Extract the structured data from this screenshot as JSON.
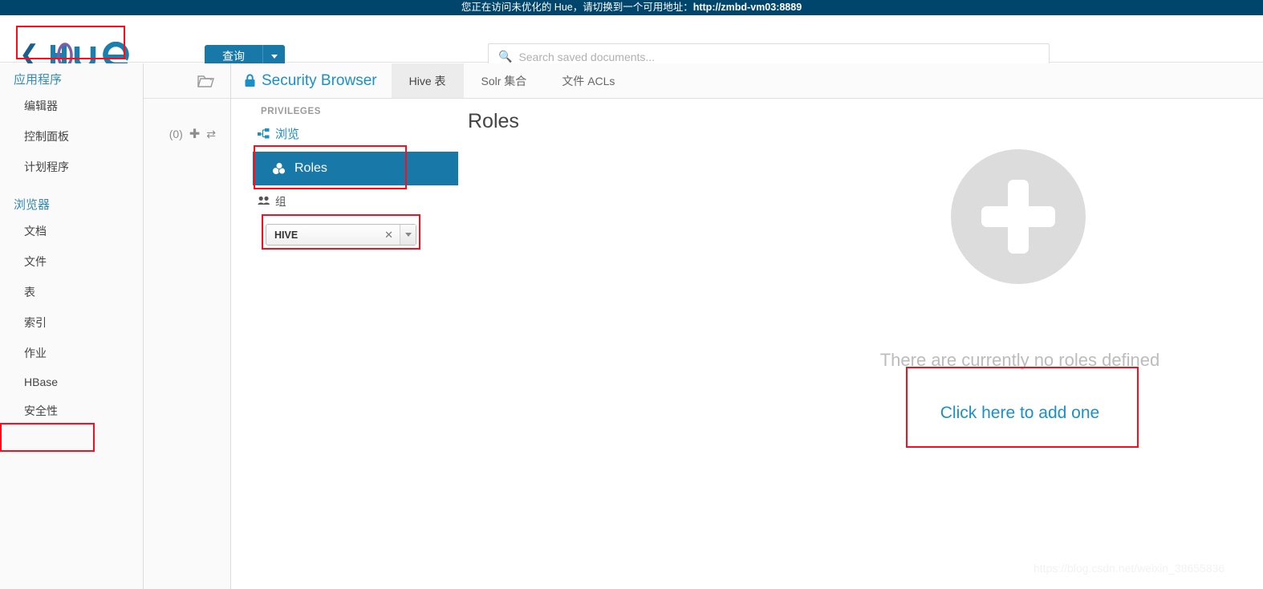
{
  "banner": {
    "text": "您正在访问未优化的 Hue，请切换到一个可用地址：",
    "url": "http://zmbd-vm03:8889"
  },
  "header": {
    "back_icon": "chevron-left-icon",
    "logo_text": "hue",
    "query_button": "查询",
    "query_caret_icon": "caret-down-icon",
    "search": {
      "icon": "search-icon",
      "placeholder": "Search saved documents...",
      "value": ""
    }
  },
  "sidebar": {
    "groups": [
      {
        "label": "应用程序",
        "items": [
          {
            "label": "编辑器"
          },
          {
            "label": "控制面板"
          },
          {
            "label": "计划程序"
          }
        ]
      },
      {
        "label": "浏览器",
        "items": [
          {
            "label": "文档"
          },
          {
            "label": "文件"
          },
          {
            "label": "表"
          },
          {
            "label": "索引"
          },
          {
            "label": "作业"
          },
          {
            "label": "HBase"
          },
          {
            "label": "安全性"
          }
        ]
      }
    ]
  },
  "assist": {
    "folder_icon": "folder-icon",
    "count": "(0)",
    "add_icon": "plus-icon",
    "refresh_icon": "refresh-icon"
  },
  "tabs": {
    "brand": {
      "label": "Security Browser",
      "icon": "lock-icon"
    },
    "items": [
      {
        "label": "Hive 表",
        "active": true
      },
      {
        "label": "Solr 集合",
        "active": false
      },
      {
        "label": "文件 ACLs",
        "active": false
      }
    ]
  },
  "privileges": {
    "heading": "PRIVILEGES",
    "browse": {
      "label": "浏览",
      "icon": "sitemap-icon"
    },
    "roles": {
      "label": "Roles",
      "icon": "cubes-icon",
      "selected": true
    },
    "group_label": {
      "label": "组",
      "icon": "users-icon"
    },
    "group_select": {
      "value": "HIVE",
      "clear_icon": "close-icon",
      "caret_icon": "caret-down-icon"
    }
  },
  "main": {
    "title": "Roles",
    "plus_icon": "plus-circle-icon",
    "empty_message": "There are currently no roles defined",
    "add_link": "Click here to add one",
    "watermark": "https://blog.csdn.net/weixin_38655836"
  },
  "colors": {
    "banner_bg": "#00456b",
    "accent_blue": "#1878a8",
    "link_blue": "#1b90c8",
    "annotation_red": "#fc0d1b",
    "placeholder_gray": "#b0b0b0",
    "empty_gray": "#bcbcbc"
  }
}
